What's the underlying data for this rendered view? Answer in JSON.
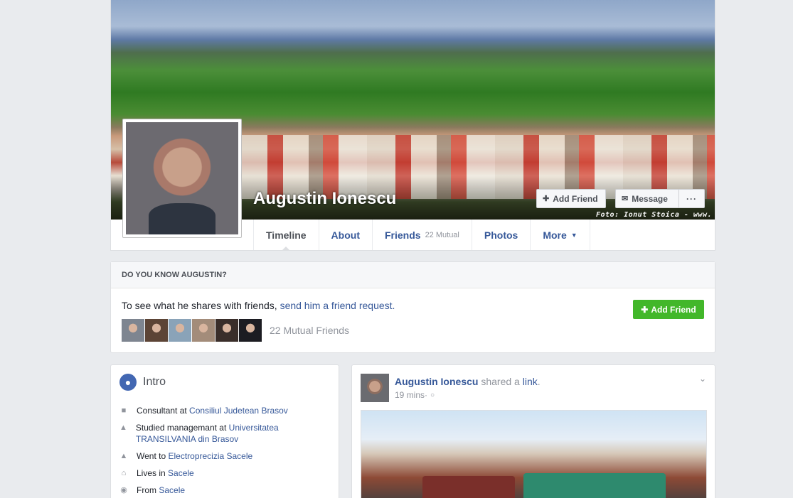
{
  "profile": {
    "name": "Augustin Ionescu",
    "cover_credit": "Foto: Ionut Stoica -   www.",
    "add_friend_label": "Add Friend",
    "message_label": "Message",
    "more_dots": "···"
  },
  "tabs": [
    {
      "label": "Timeline",
      "active": true
    },
    {
      "label": "About"
    },
    {
      "label": "Friends",
      "sub": "22 Mutual"
    },
    {
      "label": "Photos"
    },
    {
      "label": "More"
    }
  ],
  "know": {
    "heading": "DO YOU KNOW AUGUSTIN?",
    "text_prefix": "To see what he shares with friends, ",
    "text_link": "send him a friend request.",
    "mutual_label": "22 Mutual Friends",
    "add_friend_label": "Add Friend",
    "thumb_colors": [
      "#7e8590",
      "#5c4436",
      "#8aa3b8",
      "#a38c7a",
      "#3a2e2a",
      "#1c1c22"
    ]
  },
  "intro": {
    "title": "Intro",
    "items": [
      {
        "icon": "briefcase-icon",
        "prefix": "Consultant at ",
        "link": "Consiliul Judetean Brasov"
      },
      {
        "icon": "graduation-cap-icon",
        "prefix": "Studied managemant at ",
        "link": "Universitatea TRANSILVANIA din Brasov"
      },
      {
        "icon": "graduation-cap-icon",
        "prefix": "Went to ",
        "link": "Electroprecizia Sacele"
      },
      {
        "icon": "house-icon",
        "prefix": "Lives in ",
        "link": "Sacele"
      },
      {
        "icon": "location-pin-icon",
        "prefix": "From ",
        "link": "Sacele"
      }
    ]
  },
  "post": {
    "author": "Augustin Ionescu",
    "action": " shared a ",
    "object": "link",
    "period": ".",
    "time": "19 mins",
    "separator": " · "
  },
  "colors": {
    "link": "#365899",
    "green": "#42b72a",
    "background": "#e9ebee"
  }
}
